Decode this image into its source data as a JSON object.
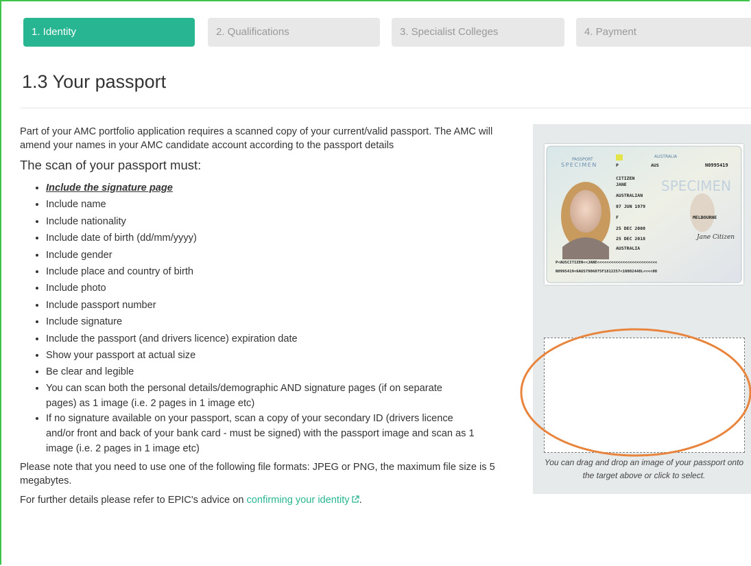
{
  "steps": [
    {
      "label": "1. Identity",
      "active": true
    },
    {
      "label": "2. Qualifications",
      "active": false
    },
    {
      "label": "3. Specialist Colleges",
      "active": false
    },
    {
      "label": "4. Payment",
      "active": false
    }
  ],
  "page_title": "1.3 Your passport",
  "intro": "Part of your AMC portfolio application requires a scanned copy of your current/valid passport. The AMC will amend your names in your AMC candidate account according to the passport details",
  "requirements_heading": "The scan of your passport must:",
  "requirements": [
    "Include the signature page",
    "Include name",
    "Include nationality",
    "Include date of birth (dd/mm/yyyy)",
    "Include gender",
    "Include place and country of birth",
    "Include photo",
    "Include passport number",
    "Include signature",
    "Include the passport (and drivers licence) expiration date",
    "Show your passport at actual size",
    "Be clear and legible",
    "You can scan both the personal details/demographic AND signature pages (if on separate pages) as 1 image (i.e. 2 pages in 1 image etc)",
    "If no signature available on your passport, scan a copy of your secondary ID (drivers licence and/or front and back of your bank card - must be signed) with the passport image and scan as 1 image (i.e. 2 pages in 1 image etc)"
  ],
  "formats_note": "Please note that you need to use one of the following file formats: JPEG or PNG, the maximum file size is 5 megabytes.",
  "further_details": {
    "prefix": "For further details please refer to EPIC's advice on ",
    "link_text": "confirming your identity",
    "suffix": "."
  },
  "passport_sample": {
    "country": "AUSTRALIA",
    "type_label": "PASSPORT",
    "specimen": "SPECIMEN",
    "type": "P",
    "code": "AUS",
    "document_no": "N0995419",
    "surname": "CITIZEN",
    "given_name": "JANE",
    "nationality": "AUSTRALIAN",
    "dob": "07 JUN 1979",
    "sex": "F",
    "place_of_birth": "MELBOURNE",
    "issue_date": "25 DEC 2008",
    "expiry_date": "25 DEC 2018",
    "authority": "AUSTRALIA",
    "signature": "Jane Citizen",
    "mrz1": "P<AUSCITIZEN<<JANE<<<<<<<<<<<<<<<<<<<<<<<<<<",
    "mrz2": "N0995419<6AUS7906075F1812257<10002448L<<<<08"
  },
  "drop_hint": "You can drag and drop an image of your passport onto the target above or click to select.",
  "colors": {
    "accent": "#28b692",
    "frame": "#3fc44a",
    "annotation": "#e8843c",
    "panel": "#e6eaea"
  },
  "icons": {
    "external_link": "external-link-icon"
  }
}
